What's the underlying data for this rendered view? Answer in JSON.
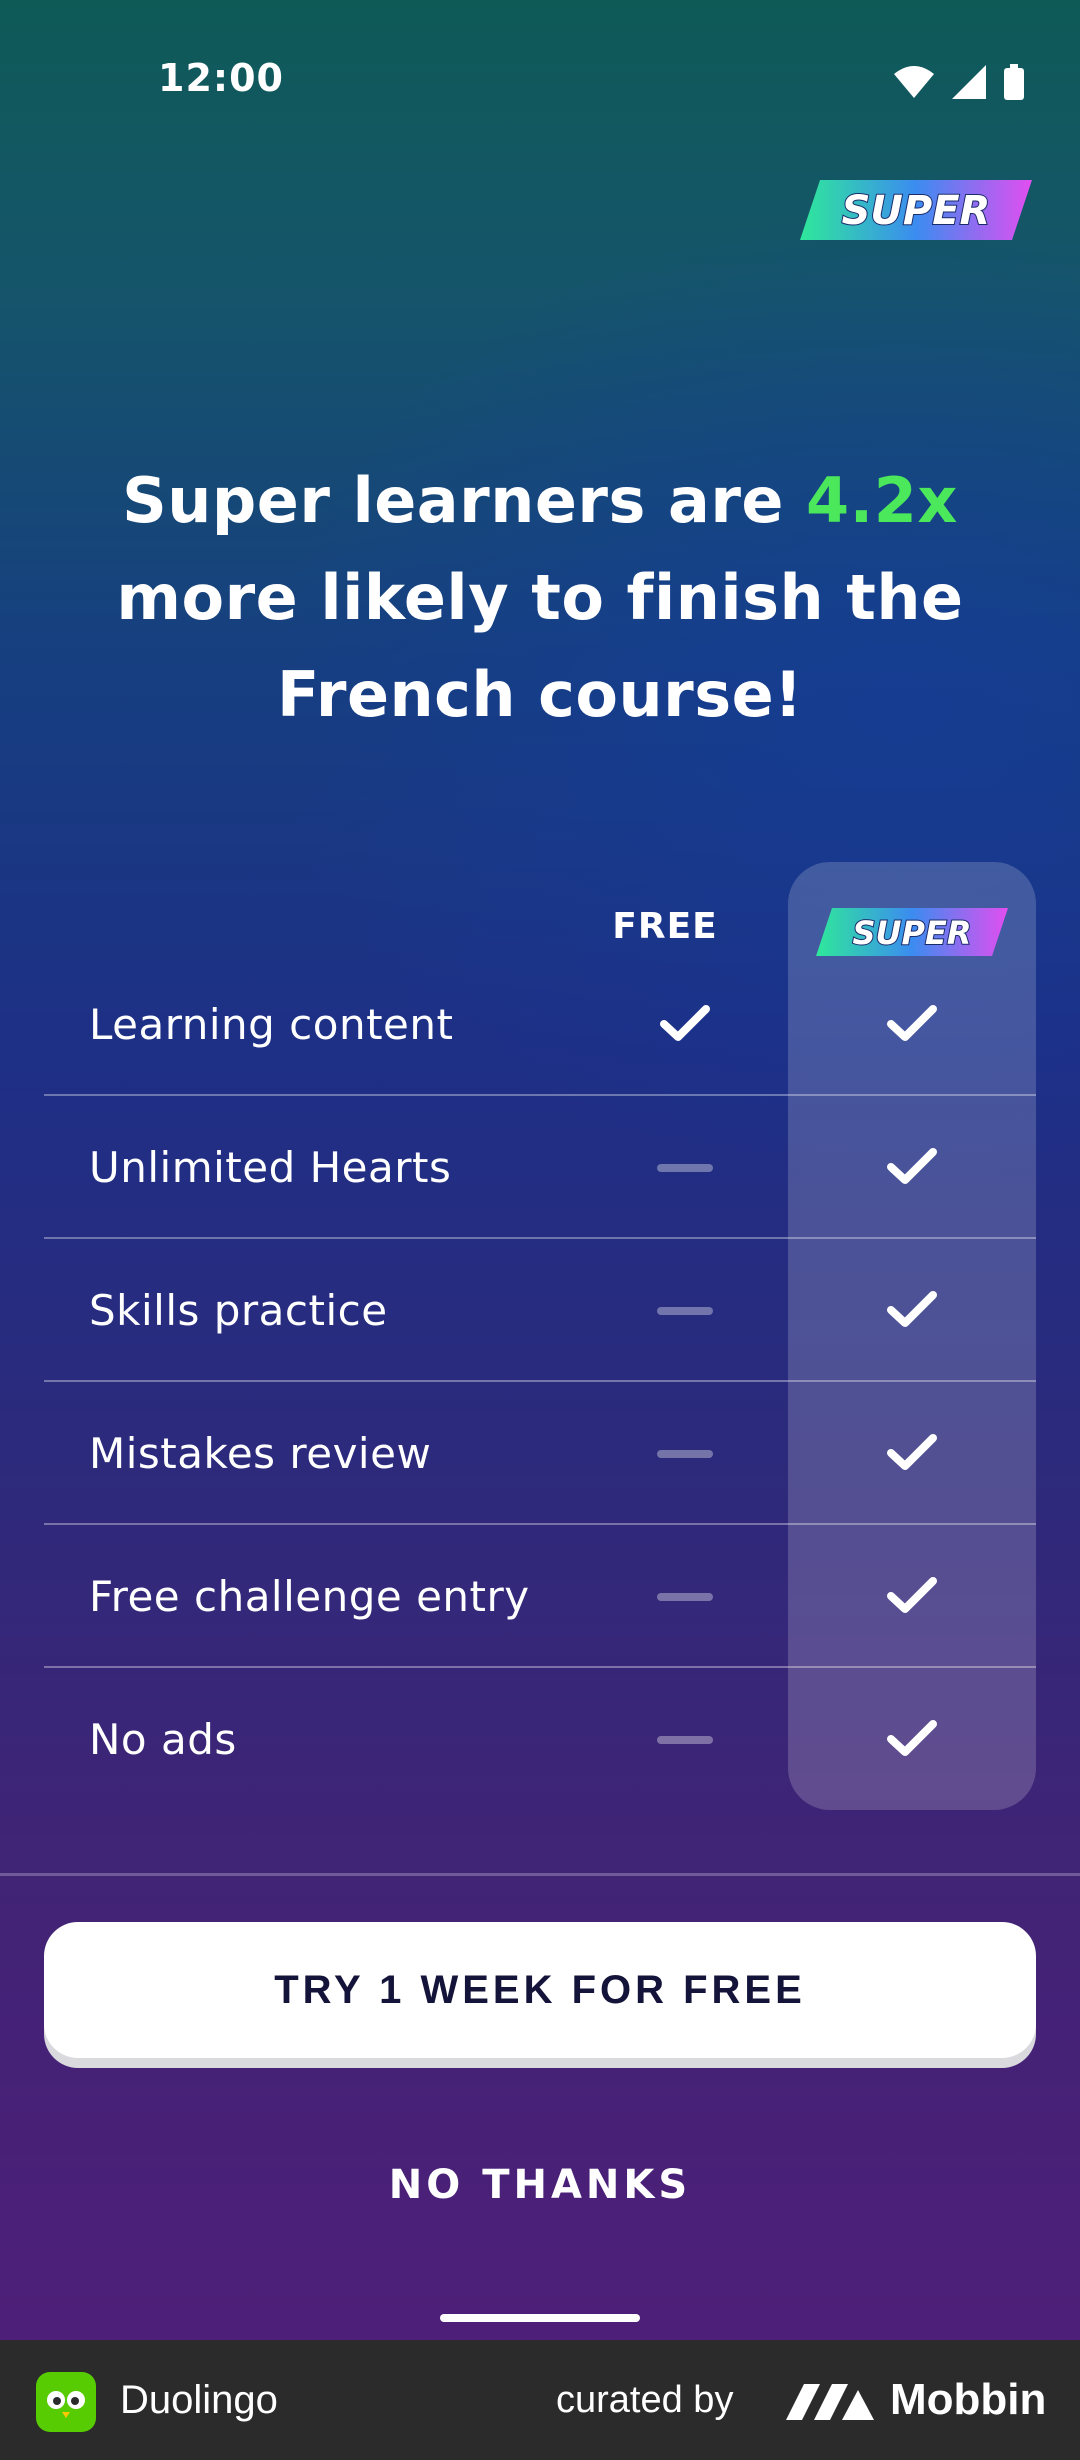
{
  "status_bar": {
    "time": "12:00"
  },
  "header": {
    "badge_text": "SUPER"
  },
  "headline": {
    "prefix": "Super learners are ",
    "highlight": "4.2x",
    "suffix": " more likely to finish the French course!"
  },
  "comparison": {
    "free_header": "FREE",
    "super_header": "SUPER",
    "rows": [
      {
        "label": "Learning content",
        "free": "check",
        "super": "check"
      },
      {
        "label": "Unlimited Hearts",
        "free": "dash",
        "super": "check"
      },
      {
        "label": "Skills practice",
        "free": "dash",
        "super": "check"
      },
      {
        "label": "Mistakes review",
        "free": "dash",
        "super": "check"
      },
      {
        "label": "Free challenge entry",
        "free": "dash",
        "super": "check"
      },
      {
        "label": "No ads",
        "free": "dash",
        "super": "check"
      }
    ]
  },
  "actions": {
    "primary_label": "TRY 1 WEEK FOR FREE",
    "secondary_label": "NO THANKS"
  },
  "footer": {
    "app_name": "Duolingo",
    "curated_by": "curated by",
    "brand": "Mobbin"
  },
  "colors": {
    "accent_green": "#4ae85a",
    "super_gradient": [
      "#2fe89a",
      "#3b8cf0",
      "#e24ef0"
    ],
    "footer_bg": "#2b2b2b"
  },
  "icons": {
    "status": [
      "wifi-icon",
      "signal-icon",
      "battery-icon"
    ],
    "row": [
      "check-icon",
      "dash-icon"
    ]
  }
}
